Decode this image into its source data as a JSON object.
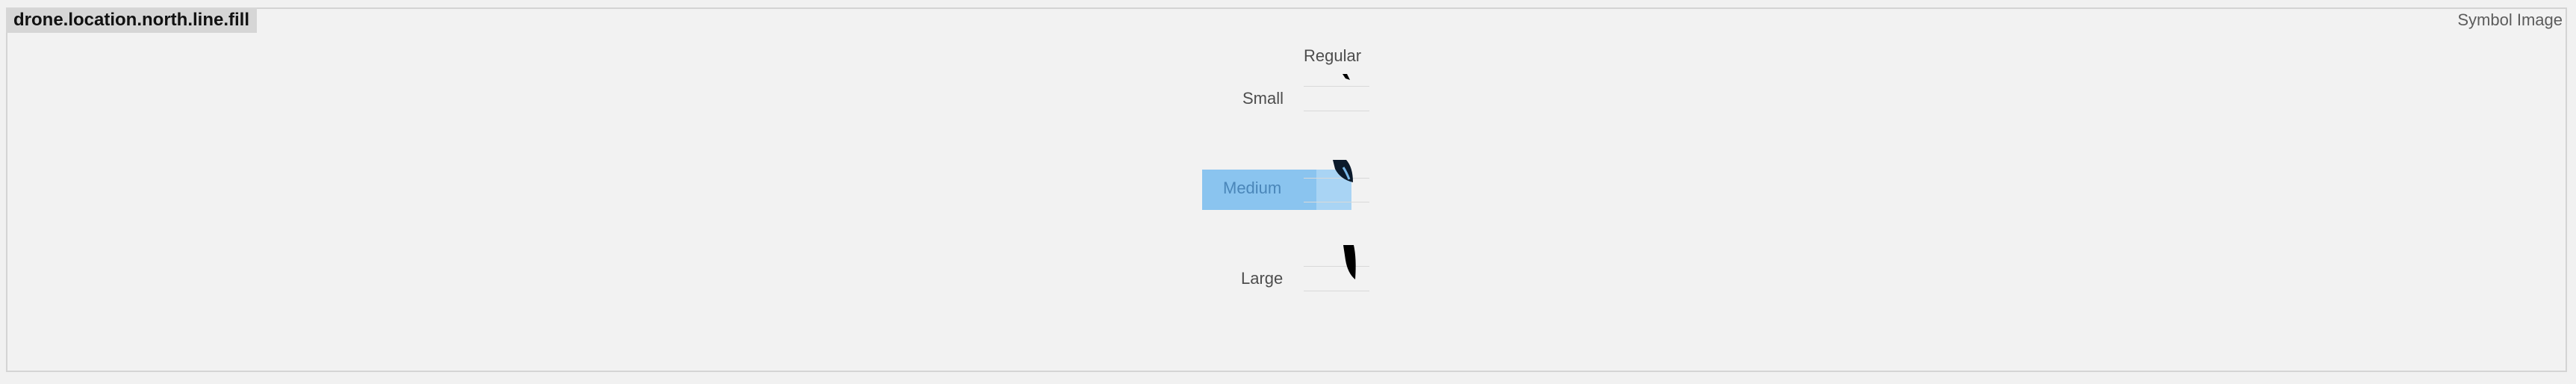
{
  "symbol": {
    "name": "drone.location.north.line.fill"
  },
  "panel": {
    "type_label": "Symbol Image"
  },
  "weights": {
    "regular": "Regular"
  },
  "sizes": {
    "small": "Small",
    "medium": "Medium",
    "large": "Large"
  },
  "colors": {
    "background": "#f2f2f2",
    "highlight": "#8ac4ef",
    "glyph": "#000000"
  },
  "icons": {
    "symbol_preview": "drone-location-north-line-fill-icon"
  }
}
